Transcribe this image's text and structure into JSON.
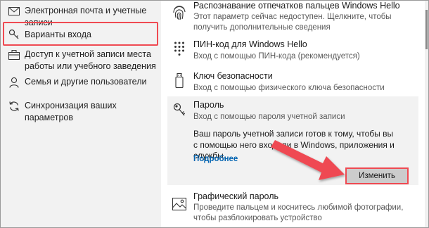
{
  "sidebar": {
    "items": [
      {
        "label": "Электронная почта и учетные записи",
        "icon": "mail-icon"
      },
      {
        "label": "Варианты входа",
        "icon": "key-icon",
        "selected": true
      },
      {
        "label": "Доступ к учетной записи места работы или учебного заведения",
        "icon": "briefcase-icon"
      },
      {
        "label": "Семья и другие пользователи",
        "icon": "person-icon"
      },
      {
        "label": "Синхронизация ваших параметров",
        "icon": "sync-icon"
      }
    ]
  },
  "options": {
    "fingerprint": {
      "title": "Распознавание отпечатков пальцев Windows Hello",
      "desc": "Этот параметр сейчас недоступен. Щелкните, чтобы получить дополнительные сведения"
    },
    "pin": {
      "title": "ПИН-код для Windows Hello",
      "desc": "Вход с помощью ПИН-кода (рекомендуется)"
    },
    "security_key": {
      "title": "Ключ безопасности",
      "desc": "Вход с помощью физического ключа безопасности"
    },
    "password": {
      "title": "Пароль",
      "desc": "Вход с помощью пароля учетной записи",
      "body": "Ваш пароль учетной записи готов к тому, чтобы вы с помощью него входили в Windows, приложения и службы.",
      "more_link": "Подробнее",
      "change_button": "Изменить"
    },
    "picture_password": {
      "title": "Графический пароль",
      "desc": "Проведите пальцем и коснитесь любимой фотографии, чтобы разблокировать устройство"
    }
  },
  "colors": {
    "highlight": "#ef4a52",
    "link": "#0063b1",
    "sidebar_bg": "#f2f2f2"
  }
}
